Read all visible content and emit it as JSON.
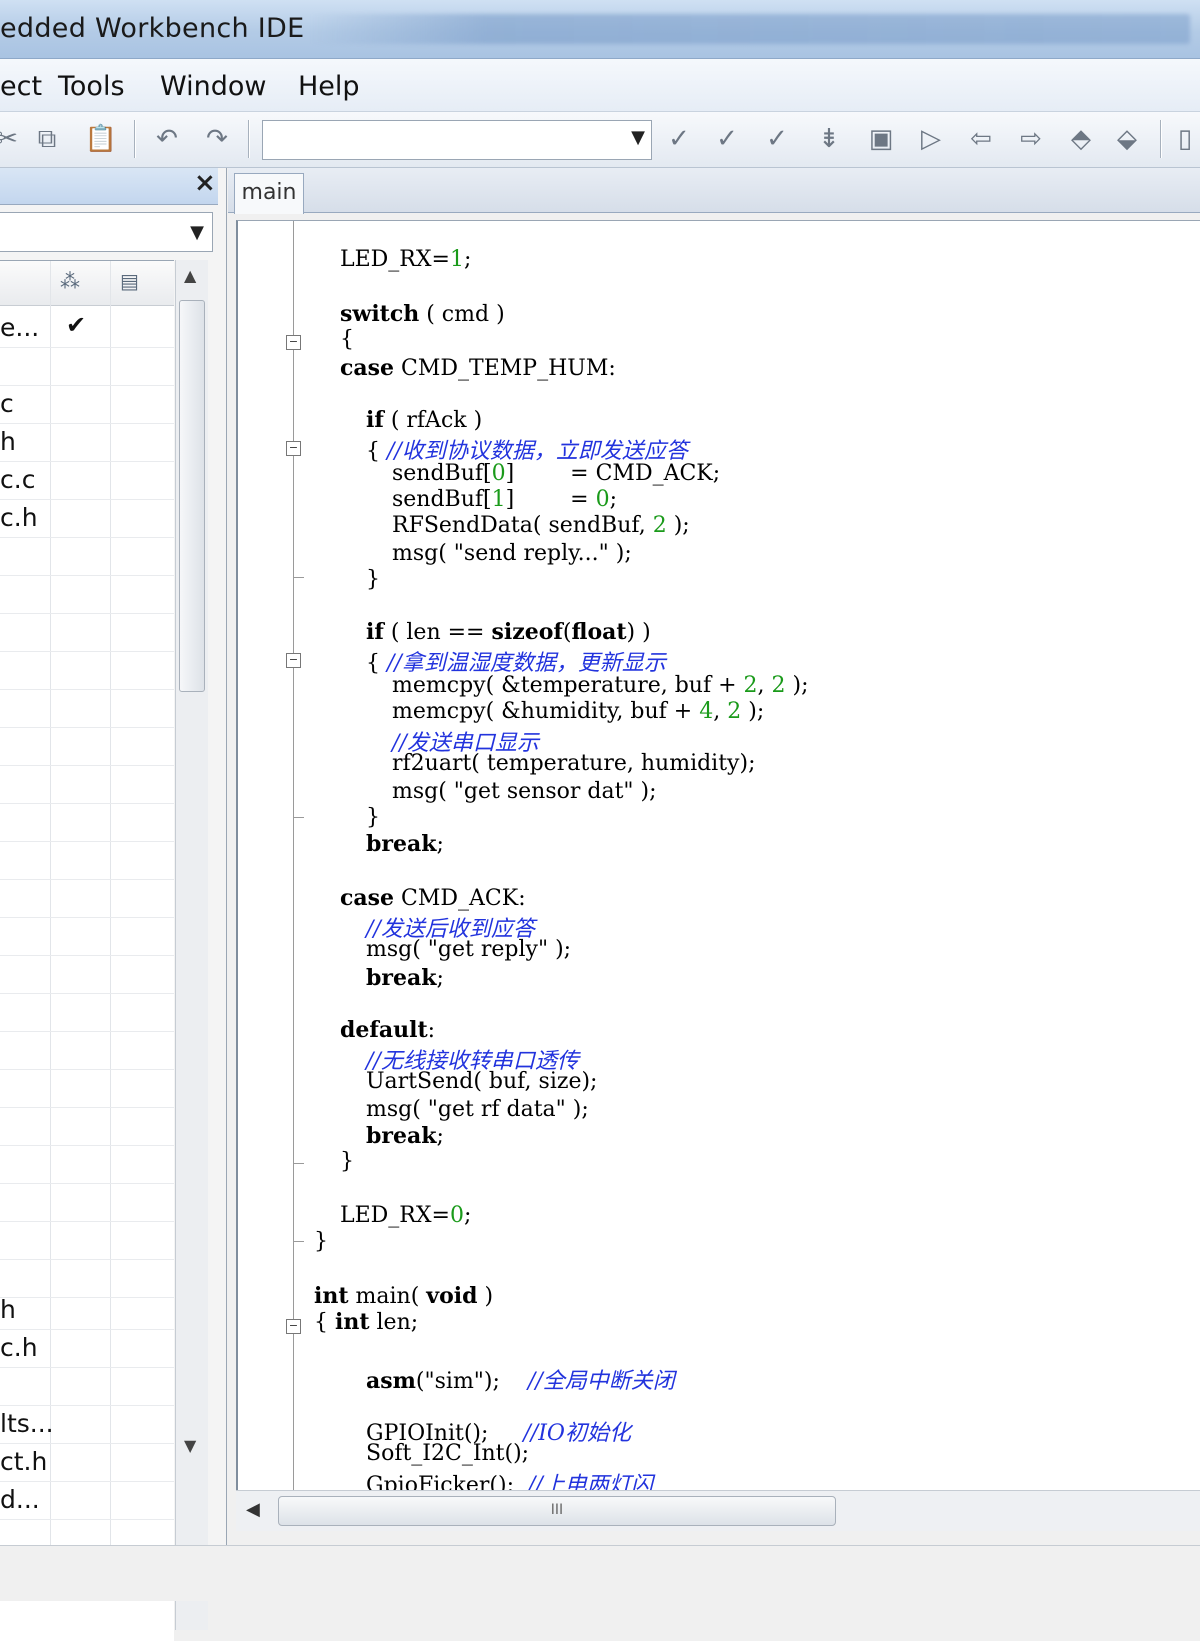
{
  "window": {
    "title": "edded Workbench IDE"
  },
  "menu": [
    "ect",
    "Tools",
    "Window",
    "Help"
  ],
  "toolbar": {
    "icons": [
      "cut-icon",
      "copy-icon",
      "paste-icon",
      "undo-icon",
      "redo-icon",
      "find-combo",
      "toggle-breakpoint-icon",
      "next-breakpoint-icon",
      "step-icon",
      "bookmark-icon",
      "template-icon",
      "go-icon",
      "nav-back-icon",
      "nav-forward-icon",
      "compile-icon",
      "make-icon"
    ],
    "find_value": ""
  },
  "workspace": {
    "close_label": "×",
    "config_value": "",
    "files": [
      {
        "name": "e...",
        "checked": "✔"
      },
      {
        "name": "",
        "checked": ""
      },
      {
        "name": "c",
        "checked": ""
      },
      {
        "name": "h",
        "checked": ""
      },
      {
        "name": "c.c",
        "checked": ""
      },
      {
        "name": "c.h",
        "checked": ""
      },
      {
        "name": "h",
        "checked": ""
      },
      {
        "name": "c.h",
        "checked": ""
      },
      {
        "name": "",
        "checked": ""
      },
      {
        "name": "lts...",
        "checked": ""
      },
      {
        "name": "ct.h",
        "checked": ""
      },
      {
        "name": "d...",
        "checked": ""
      }
    ]
  },
  "editor": {
    "tab": "main",
    "scroll_thumb_label": "III"
  }
}
